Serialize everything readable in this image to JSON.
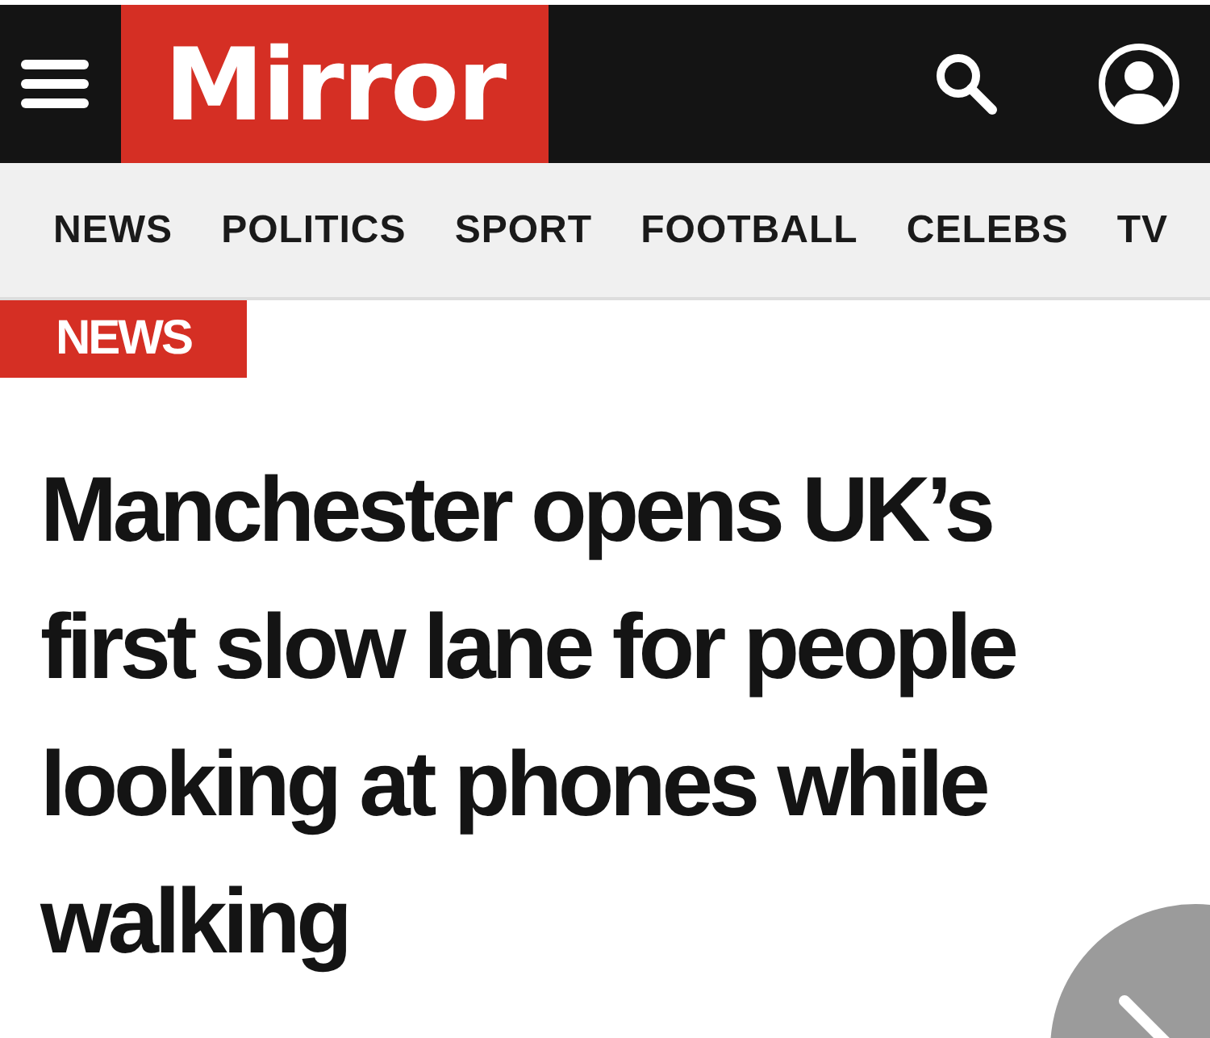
{
  "header": {
    "logo": "Mirror"
  },
  "nav": {
    "items": [
      {
        "label": "NEWS"
      },
      {
        "label": "POLITICS"
      },
      {
        "label": "SPORT"
      },
      {
        "label": "FOOTBALL"
      },
      {
        "label": "CELEBS"
      },
      {
        "label": "TV"
      }
    ]
  },
  "article": {
    "section": "NEWS",
    "headline": "Manchester opens UK’s first slow lane for people looking at phones while walking"
  }
}
